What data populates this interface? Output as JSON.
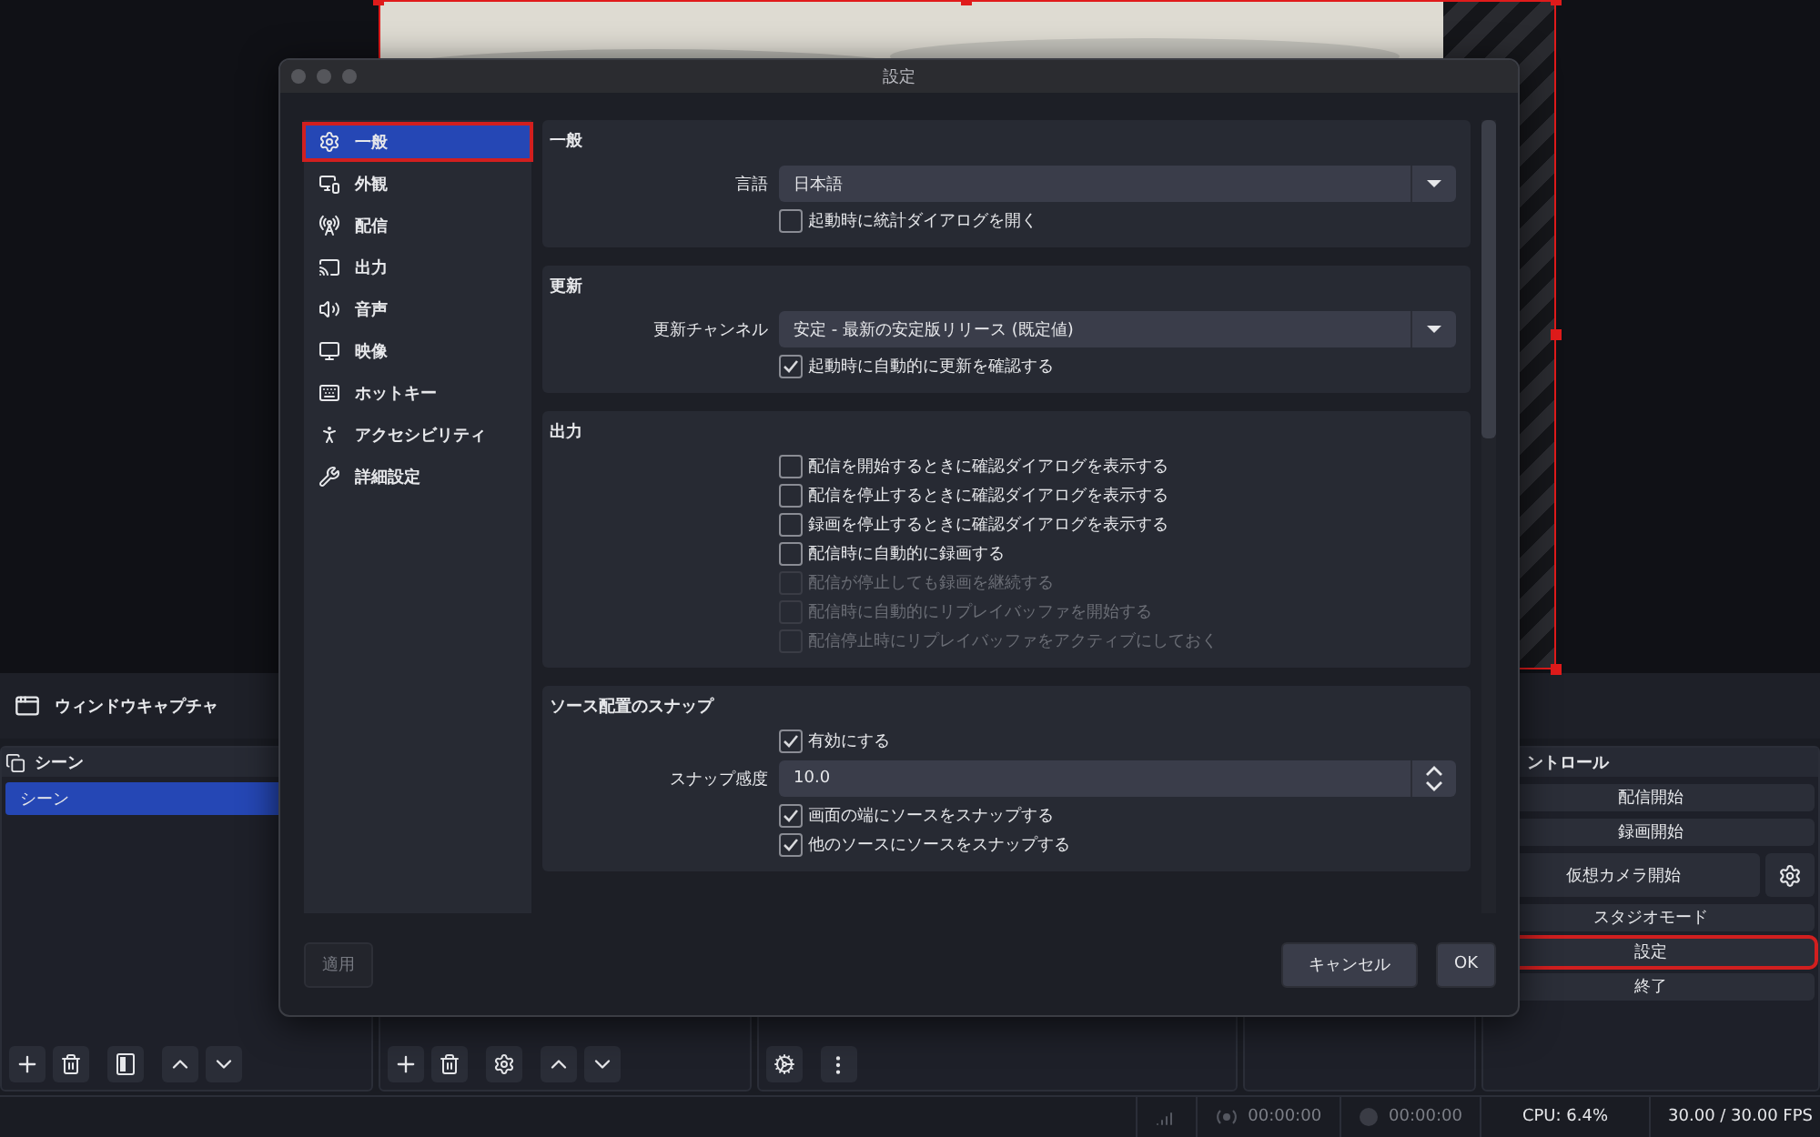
{
  "dialog": {
    "title": "設定",
    "sidebar": [
      {
        "label": "一般",
        "selected": true,
        "highlighted": true
      },
      {
        "label": "外観",
        "selected": false,
        "highlighted": false
      },
      {
        "label": "配信",
        "selected": false,
        "highlighted": false
      },
      {
        "label": "出力",
        "selected": false,
        "highlighted": false
      },
      {
        "label": "音声",
        "selected": false,
        "highlighted": false
      },
      {
        "label": "映像",
        "selected": false,
        "highlighted": false
      },
      {
        "label": "ホットキー",
        "selected": false,
        "highlighted": false
      },
      {
        "label": "アクセシビリティ",
        "selected": false,
        "highlighted": false
      },
      {
        "label": "詳細設定",
        "selected": false,
        "highlighted": false
      }
    ],
    "sections": [
      {
        "title": "一般",
        "rows": [
          {
            "kind": "select",
            "label": "言語",
            "value": "日本語"
          },
          {
            "kind": "checkbox",
            "label": "起動時に統計ダイアログを開く",
            "checked": false,
            "disabled": false
          }
        ]
      },
      {
        "title": "更新",
        "rows": [
          {
            "kind": "select",
            "label": "更新チャンネル",
            "value": "安定 - 最新の安定版リリース (既定値)"
          },
          {
            "kind": "checkbox",
            "label": "起動時に自動的に更新を確認する",
            "checked": true,
            "disabled": false
          }
        ]
      },
      {
        "title": "出力",
        "rows": [
          {
            "kind": "checkbox",
            "label": "配信を開始するときに確認ダイアログを表示する",
            "checked": false,
            "disabled": false
          },
          {
            "kind": "checkbox",
            "label": "配信を停止するときに確認ダイアログを表示する",
            "checked": false,
            "disabled": false
          },
          {
            "kind": "checkbox",
            "label": "録画を停止するときに確認ダイアログを表示する",
            "checked": false,
            "disabled": false
          },
          {
            "kind": "checkbox",
            "label": "配信時に自動的に録画する",
            "checked": false,
            "disabled": false
          },
          {
            "kind": "checkbox",
            "label": "配信が停止しても録画を継続する",
            "checked": false,
            "disabled": true
          },
          {
            "kind": "checkbox",
            "label": "配信時に自動的にリプレイバッファを開始する",
            "checked": false,
            "disabled": true
          },
          {
            "kind": "checkbox",
            "label": "配信停止時にリプレイバッファをアクティブにしておく",
            "checked": false,
            "disabled": true
          }
        ]
      },
      {
        "title": "ソース配置のスナップ",
        "rows": [
          {
            "kind": "checkbox",
            "label": "有効にする",
            "checked": true,
            "disabled": false
          },
          {
            "kind": "spin",
            "label": "スナップ感度",
            "value": "10.0"
          },
          {
            "kind": "checkbox",
            "label": "画面の端にソースをスナップする",
            "checked": true,
            "disabled": false
          },
          {
            "kind": "checkbox",
            "label": "他のソースにソースをスナップする",
            "checked": true,
            "disabled": false
          }
        ]
      }
    ],
    "buttons": [
      {
        "label": "適用",
        "disabled": true
      },
      {
        "label": "キャンセル",
        "disabled": false
      },
      {
        "label": "OK",
        "disabled": false
      }
    ]
  },
  "source_toolbar": {
    "source": "ウィンドウキャプチャ"
  },
  "scenes": {
    "title": "シーン",
    "items": [
      {
        "label": "シーン",
        "selected": true
      }
    ]
  },
  "controls": {
    "title": "ントロール",
    "buttons": [
      {
        "label": "配信開始",
        "kind": "plain",
        "highlighted": false
      },
      {
        "label": "録画開始",
        "kind": "plain",
        "highlighted": false
      },
      {
        "label": "仮想カメラ開始",
        "kind": "with_settings",
        "highlighted": false
      },
      {
        "label": "スタジオモード",
        "kind": "plain",
        "highlighted": false
      },
      {
        "label": "設定",
        "kind": "plain",
        "highlighted": true
      },
      {
        "label": "終了",
        "kind": "plain",
        "highlighted": false
      }
    ]
  },
  "status_bar": {
    "stream_time": "00:00:00",
    "record_time": "00:00:00",
    "cpu": "CPU: 6.4%",
    "fps": "30.00 / 30.00 FPS"
  }
}
